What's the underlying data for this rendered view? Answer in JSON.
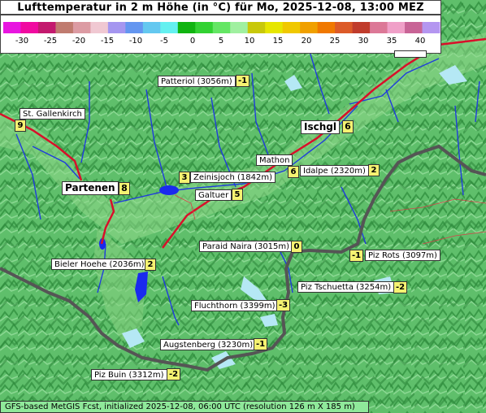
{
  "title": "Lufttemperatur in 2 m Höhe (in °C) für Mo, 2025-12-08, 13:00 MEZ",
  "legend": {
    "ticks": [
      "-30",
      "-25",
      "-20",
      "-15",
      "-10",
      "-5",
      "0",
      "5",
      "10",
      "15",
      "20",
      "25",
      "30",
      "35",
      "40"
    ],
    "colors": [
      "#e815e0",
      "#f00aa0",
      "#c3196e",
      "#c07b6f",
      "#dc9ba3",
      "#f0c8d2",
      "#a596f0",
      "#6496f0",
      "#64c8f0",
      "#64f0f0",
      "#10b410",
      "#32d232",
      "#64e664",
      "#a0f0a0",
      "#c8c80a",
      "#e6e600",
      "#f0c800",
      "#f0a000",
      "#f07800",
      "#dc5a28",
      "#c03c2c",
      "#dc7897",
      "#f0a0c8",
      "#c86496",
      "#b496f0"
    ]
  },
  "footer": "GFS-based MetGIS Fcst, initialized 2025-12-08, 06:00 UTC  (resolution 126 m X 185 m)",
  "places": [
    {
      "name": "Patteriol (3056m)",
      "value": "-1"
    },
    {
      "name": "St. Gallenkirch",
      "value": "9"
    },
    {
      "name": "Ischgl",
      "value": "6"
    },
    {
      "name": "Mathon",
      "value": "6"
    },
    {
      "name": "Idalpe (2320m)",
      "value": "2"
    },
    {
      "name": "Zeinisjoch (1842m)",
      "value": "3"
    },
    {
      "name": "Partenen",
      "value": "8"
    },
    {
      "name": "Galtuer",
      "value": "5"
    },
    {
      "name": "Paraid Naira (3015m)",
      "value": "0"
    },
    {
      "name": "Piz Rots (3097m)",
      "value": "-1"
    },
    {
      "name": "Bieler Hoehe (2036m)",
      "value": "2"
    },
    {
      "name": "Piz Tschuetta (3254m)",
      "value": "-2"
    },
    {
      "name": "Fluchthorn (3399m)",
      "value": "-3"
    },
    {
      "name": "Augstenberg (3230m)",
      "value": "-1"
    },
    {
      "name": "Piz Buin (3312m)",
      "value": "-2"
    }
  ]
}
